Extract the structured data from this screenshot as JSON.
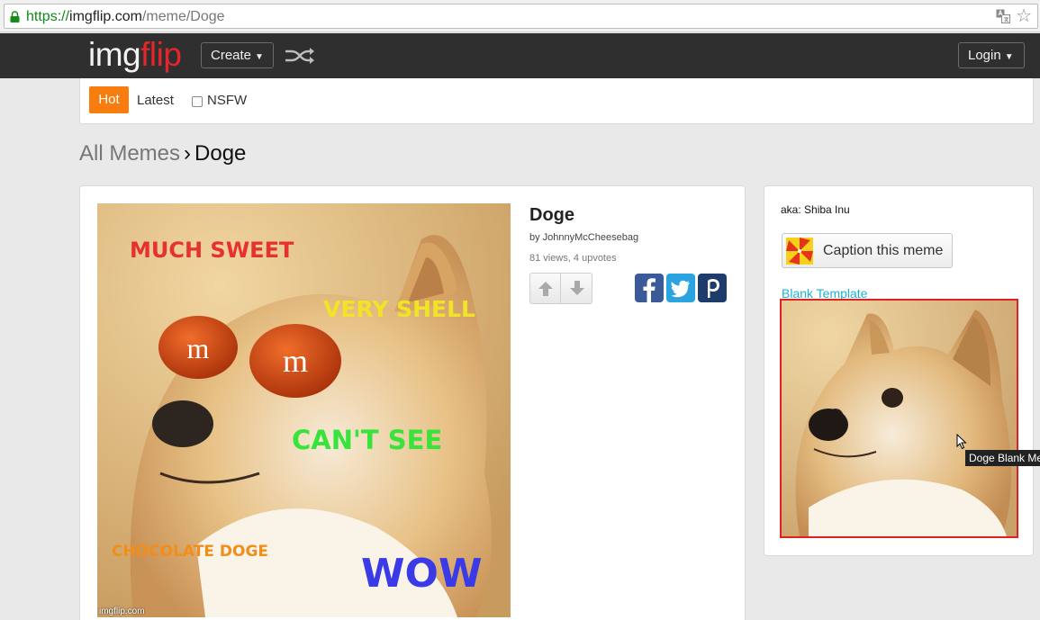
{
  "browser": {
    "url_scheme": "https://",
    "url_host": "imgflip.com",
    "url_path": "/meme/Doge"
  },
  "header": {
    "logo_part1": "img",
    "logo_part2": "flip",
    "create_label": "Create",
    "login_label": "Login"
  },
  "filters": {
    "hot_label": "Hot",
    "latest_label": "Latest",
    "nsfw_label": "NSFW"
  },
  "breadcrumb": {
    "all_label": "All Memes",
    "separator": "›",
    "current_label": "Doge"
  },
  "meme": {
    "captions": [
      "MUCH SWEET",
      "VERY SHELL",
      "CAN'T SEE",
      "CHOCOLATE DOGE",
      "WOW"
    ],
    "candy_letter": "m",
    "watermark": "imgflip.com",
    "title": "Doge",
    "author": "by JohnnyMcCheesebag",
    "stats": "81 views, 4 upvotes"
  },
  "sidebar": {
    "aka": "aka: Shiba Inu",
    "caption_button_label": "Caption this meme",
    "blank_template_label": "Blank Template",
    "tooltip": "Doge Blank Me"
  },
  "colors": {
    "accent_orange": "#f77d0f",
    "header_bg": "#2f2f2f",
    "logo_red": "#e3262c",
    "link_blue": "#1ab3d6",
    "highlight_red": "#e02121"
  },
  "icons": [
    "lock-icon",
    "translate-icon",
    "star-icon",
    "caret-down-icon",
    "shuffle-icon",
    "arrow-up-icon",
    "arrow-down-icon",
    "facebook-icon",
    "twitter-icon",
    "pinterest-icon",
    "pinwheel-icon",
    "cursor-icon"
  ]
}
